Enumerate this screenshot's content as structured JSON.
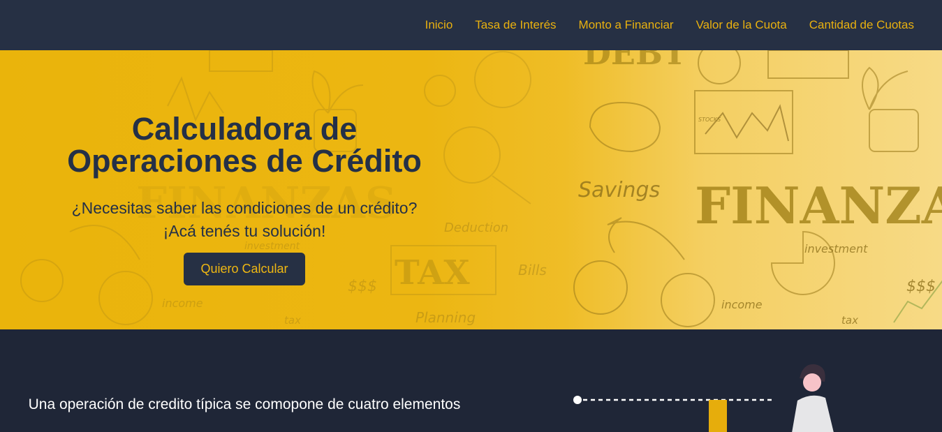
{
  "nav": {
    "items": [
      {
        "label": "Inicio"
      },
      {
        "label": "Tasa de Interés"
      },
      {
        "label": "Monto a Financiar"
      },
      {
        "label": "Valor de la Cuota"
      },
      {
        "label": "Cantidad de Cuotas"
      }
    ]
  },
  "hero": {
    "title_line1": "Calculadora de",
    "title_line2": "Operaciones de Crédito",
    "subtitle_line1": "¿Necesitas saber las condiciones de un crédito?",
    "subtitle_line2": "¡Acá tenés tu solución!",
    "cta_label": "Quiero Calcular",
    "background_words": {
      "finanzas_main": "FINANZAS",
      "finanzas_faded": "FINANZAS",
      "savings": "Savings",
      "tax": "TAX",
      "deduction": "Deduction",
      "bills": "Bills",
      "planning": "Planning",
      "investment_right": "investment",
      "investment_left": "investment",
      "income_right": "income",
      "income_left": "income",
      "tax_small_right": "tax",
      "tax_small_left": "tax",
      "dollars_right": "$$$",
      "dollars_left": "$$$",
      "stocks": "STOCKS",
      "debt": "DEBT"
    }
  },
  "section": {
    "text": "Una operación de credito típica se comopone de cuatro elementos"
  },
  "colors": {
    "nav_bg": "#263044",
    "accent": "#e9b10f",
    "hero_text": "#243047",
    "section_bg": "#1f2637"
  }
}
